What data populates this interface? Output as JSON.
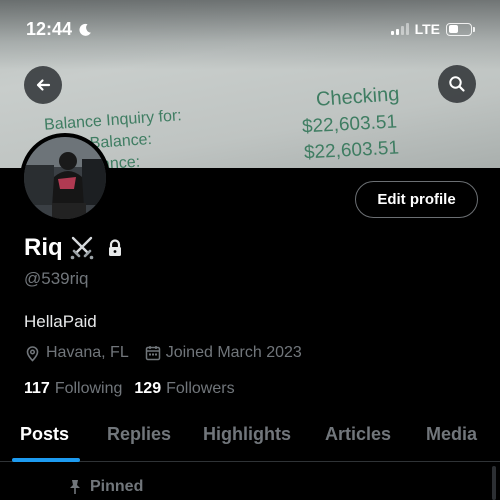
{
  "status_bar": {
    "time": "12:44",
    "network": "LTE",
    "moon_icon": "moon-icon",
    "signal_icon": "cellular-signal-icon",
    "battery_icon": "battery-icon"
  },
  "banner": {
    "receipt_header": "Checking",
    "receipt_line1": "Balance Inquiry for:",
    "receipt_line2": "ble Balance:",
    "receipt_line3": "l Balance:",
    "receipt_value1": "$22,603.51",
    "receipt_value2": "$22,603.51"
  },
  "nav": {
    "back_icon": "arrow-left-icon",
    "search_icon": "search-icon"
  },
  "profile": {
    "display_name": "Riq",
    "name_emoji": "⚔️",
    "lock_icon": "lock-icon",
    "handle": "@539riq",
    "bio": "HellaPaid",
    "location": "Havana, FL",
    "joined": "Joined March 2023",
    "following_count": "117",
    "following_label": "Following",
    "followers_count": "129",
    "followers_label": "Followers",
    "edit_button": "Edit profile"
  },
  "tabs": [
    {
      "label": "Posts",
      "active": true
    },
    {
      "label": "Replies",
      "active": false
    },
    {
      "label": "Highlights",
      "active": false
    },
    {
      "label": "Articles",
      "active": false
    },
    {
      "label": "Media",
      "active": false
    }
  ],
  "pinned": {
    "label": "Pinned",
    "icon": "pin-icon"
  },
  "colors": {
    "background": "#000000",
    "accent": "#1d9bf0",
    "secondary_text": "#71767b",
    "receipt_ink": "#3f7d62"
  }
}
